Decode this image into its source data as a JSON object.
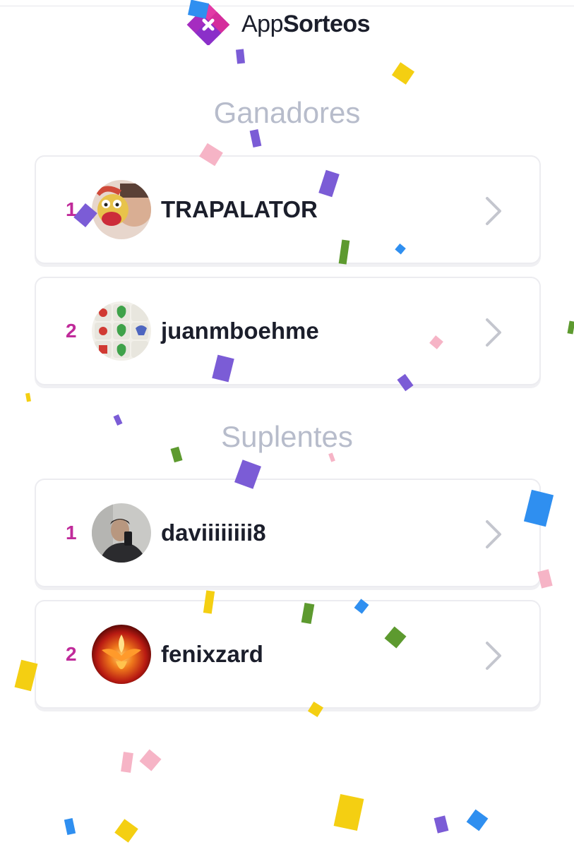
{
  "brand": {
    "name_light": "App",
    "name_bold": "Sorteos"
  },
  "sections": {
    "winners_title": "Ganadores",
    "substitutes_title": "Suplentes"
  },
  "winners": [
    {
      "rank": "1",
      "username": "TRAPALATOR"
    },
    {
      "rank": "2",
      "username": "juanmboehme"
    }
  ],
  "substitutes": [
    {
      "rank": "1",
      "username": "daviiiiiiii8"
    },
    {
      "rank": "2",
      "username": "fenixzard"
    }
  ],
  "colors": {
    "rank": "#c02a9a",
    "title": "#b7bccb",
    "logo_magenta": "#d42d9c",
    "logo_purple": "#8b2fc9"
  }
}
